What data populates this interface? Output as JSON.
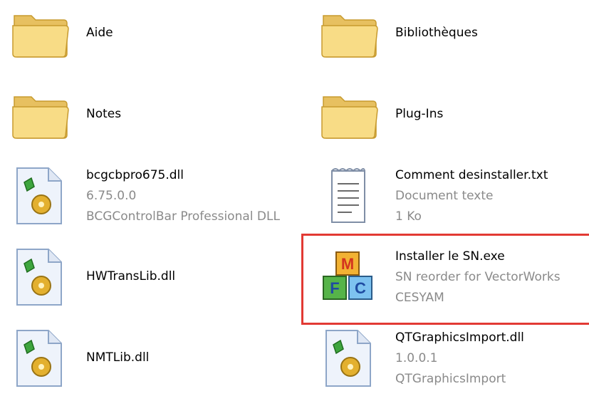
{
  "items": [
    {
      "name": "Aide",
      "icon": "folder-icon",
      "lines": []
    },
    {
      "name": "Bibliothèques",
      "icon": "folder-icon",
      "lines": []
    },
    {
      "name": "Notes",
      "icon": "folder-icon",
      "lines": []
    },
    {
      "name": "Plug-Ins",
      "icon": "folder-icon",
      "lines": []
    },
    {
      "name": "bcgcbpro675.dll",
      "icon": "dll-icon",
      "lines": [
        "6.75.0.0",
        "BCGControlBar Professional DLL"
      ]
    },
    {
      "name": "Comment desinstaller.txt",
      "icon": "text-document-icon",
      "lines": [
        "Document texte",
        "1 Ko"
      ]
    },
    {
      "name": "HWTransLib.dll",
      "icon": "dll-icon",
      "lines": []
    },
    {
      "name": "Installer le SN.exe",
      "icon": "mfc-app-icon",
      "lines": [
        "SN reorder for VectorWorks",
        "CESYAM"
      ]
    },
    {
      "name": "NMTLib.dll",
      "icon": "dll-icon",
      "lines": []
    },
    {
      "name": "QTGraphicsImport.dll",
      "icon": "dll-icon",
      "lines": [
        "1.0.0.1",
        "QTGraphicsImport"
      ]
    }
  ],
  "colors": {
    "highlight": "#e23a34",
    "folder": "#f3d57a",
    "secondary_text": "#8a8a8a"
  }
}
